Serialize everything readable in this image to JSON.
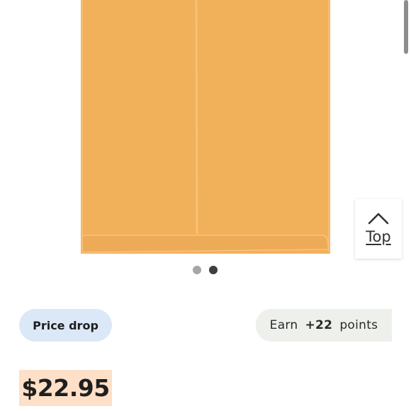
{
  "product": {
    "image_icon": "manila-envelope-image",
    "envelope_color": "#f2b25c",
    "envelope_shade": "#e9a64f"
  },
  "carousel": {
    "dots": [
      {
        "state": "inactive",
        "color": "#a6a6a6"
      },
      {
        "state": "active",
        "color": "#3f3f3f"
      }
    ]
  },
  "top_button": {
    "icon": "chevron-up-icon",
    "label": "Top"
  },
  "badges": {
    "price_drop": {
      "label": "Price drop",
      "background": "#dbe8f7"
    },
    "points": {
      "prefix": "Earn",
      "value": "+22",
      "suffix": "points",
      "background": "#eef0ec"
    }
  },
  "price": {
    "value": "$22.95",
    "highlight": "#fde0c7"
  },
  "scrollbar": {
    "color": "#8d8d8d"
  }
}
